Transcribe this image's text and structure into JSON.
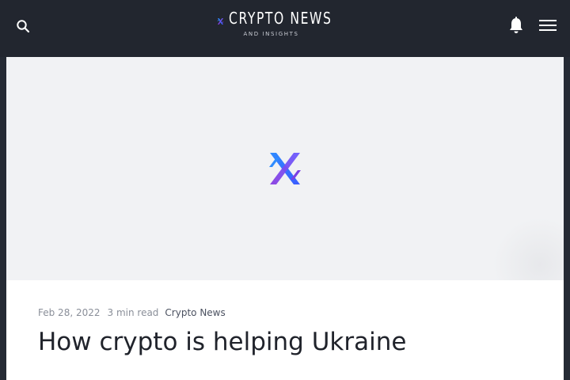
{
  "header": {
    "logo_title": "CRYPTO NEWS",
    "logo_subtitle": "AND INSIGHTS",
    "icons": [
      "search-icon",
      "bell-icon",
      "menu-icon"
    ]
  },
  "hero": {
    "image": "brand-logo-icon"
  },
  "article": {
    "date": "Feb 28, 2022",
    "read_time": "3 min read",
    "category": "Crypto News",
    "title": "How crypto is helping Ukraine"
  },
  "colors": {
    "header_bg": "#22262f",
    "hero_bg": "#f1f2f4",
    "accent_blue": "#2f6cff",
    "accent_purple": "#7b3fe4",
    "title_text": "#20232b",
    "meta_text": "#8a8f99"
  }
}
